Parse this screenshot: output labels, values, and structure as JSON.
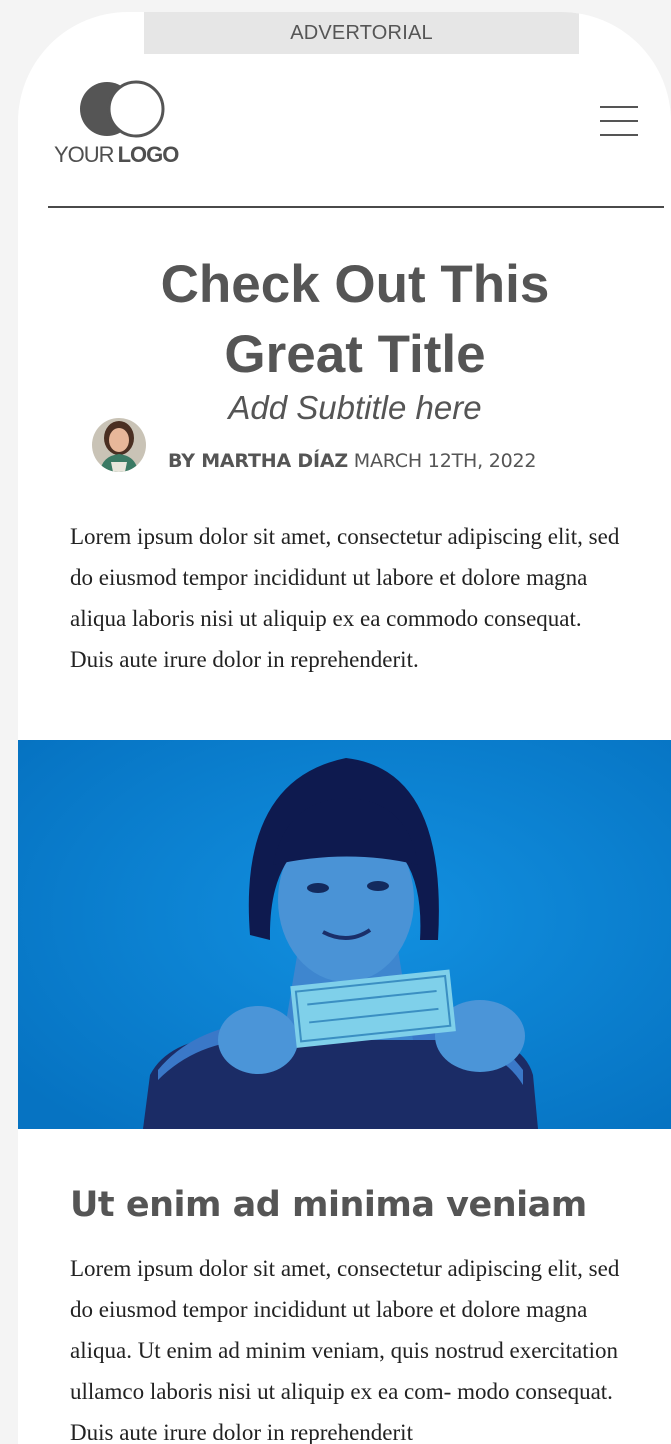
{
  "banner": {
    "label": "ADVERTORIAL"
  },
  "logo": {
    "light": "YOUR",
    "bold": "LOGO"
  },
  "article": {
    "title_line1": "Check Out This",
    "title_line2": "Great Title",
    "subtitle": "Add Subtitle here",
    "author": "BY MARTHA DÍAZ",
    "date": "MARCH 12TH, 2022",
    "intro": "Lorem ipsum dolor sit amet, consectetur adipiscing elit, sed do eiusmod tempor incididunt ut labore et dolore magna aliqua laboris nisi ut aliquip ex ea commodo consequat. Duis aute irure dolor in reprehenderit.",
    "section_heading": "Ut enim ad minima veniam",
    "section_body": "Lorem ipsum dolor sit amet, consectetur adipiscing elit, sed do eiusmod tempor incididunt ut labore et dolore magna aliqua. Ut enim ad minim veniam, quis nostrud exercitation ullamco laboris nisi ut aliquip ex ea com- modo consequat. Duis aute irure dolor in reprehenderit"
  },
  "icons": {
    "menu": "hamburger-menu-icon",
    "logo": "overlapping-circles-icon"
  },
  "colors": {
    "hero_background": "#0a84d6",
    "heading": "#555555",
    "body_text": "#222222"
  }
}
